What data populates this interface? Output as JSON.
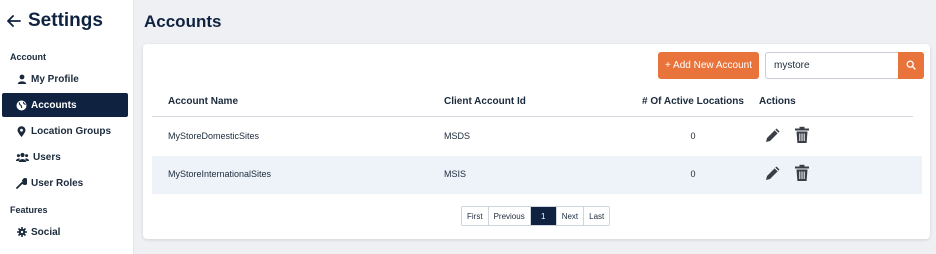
{
  "sidebar": {
    "title": "Settings",
    "sections": [
      {
        "label": "Account"
      },
      {
        "label": "Features"
      }
    ],
    "items": [
      {
        "label": "My Profile",
        "icon": "user-icon"
      },
      {
        "label": "Accounts",
        "icon": "globe-icon",
        "active": true
      },
      {
        "label": "Location Groups",
        "icon": "map-pin-icon"
      },
      {
        "label": "Users",
        "icon": "users-icon"
      },
      {
        "label": "User Roles",
        "icon": "wrench-icon"
      },
      {
        "label": "Social",
        "icon": "gear-icon"
      }
    ]
  },
  "page": {
    "title": "Accounts"
  },
  "toolbar": {
    "add_label": "+ Add New Account",
    "search_value": "mystore"
  },
  "table": {
    "columns": [
      "Account Name",
      "Client Account Id",
      "# Of Active Locations",
      "Actions"
    ],
    "rows": [
      {
        "name": "MyStoreDomesticSites",
        "client_id": "MSDS",
        "active_locations": "0"
      },
      {
        "name": "MyStoreInternationalSites",
        "client_id": "MSIS",
        "active_locations": "0"
      }
    ]
  },
  "pagination": {
    "first": "First",
    "previous": "Previous",
    "current": "1",
    "next": "Next",
    "last": "Last"
  },
  "colors": {
    "navy": "#0f2340",
    "accent": "#e8743b",
    "row_alt": "#eef2f9"
  }
}
